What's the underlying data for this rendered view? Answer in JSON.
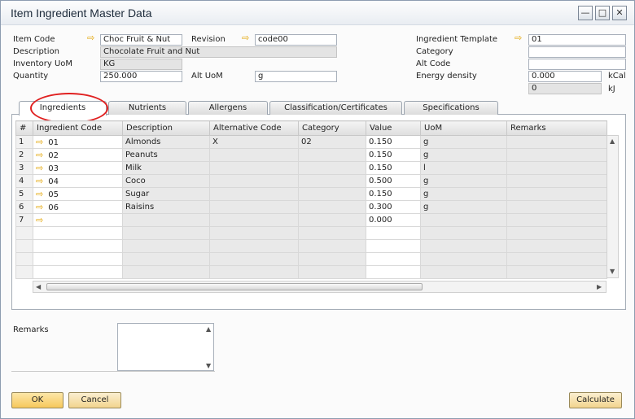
{
  "window": {
    "title": "Item Ingredient Master Data",
    "minimize": "—",
    "maximize": "□",
    "close": "✕"
  },
  "header": {
    "item_code_label": "Item Code",
    "item_code": "Choc Fruit & Nut",
    "revision_label": "Revision",
    "revision": "code00",
    "description_label": "Description",
    "description": "Chocolate Fruit and Nut",
    "inv_uom_label": "Inventory UoM",
    "inv_uom": "KG",
    "quantity_label": "Quantity",
    "quantity": "250.000",
    "alt_uom_label": "Alt UoM",
    "alt_uom": "g",
    "ingredient_template_label": "Ingredient Template",
    "ingredient_template": "01",
    "category_label": "Category",
    "category": "",
    "alt_code_label": "Alt Code",
    "alt_code": "",
    "energy_label": "Energy density",
    "energy_kcal": "0.000",
    "kcal_unit": "kCal",
    "energy_kj": "0",
    "kj_unit": "kJ"
  },
  "tabs": [
    "Ingredients",
    "Nutrients",
    "Allergens",
    "Classification/Certificates",
    "Specifications"
  ],
  "grid": {
    "columns": [
      "#",
      "Ingredient Code",
      "Description",
      "Alternative Code",
      "Category",
      "Value",
      "UoM",
      "Remarks"
    ],
    "rows": [
      {
        "n": "1",
        "code": "01",
        "desc": "Almonds",
        "alt": "X",
        "cat": "02",
        "value": "0.150",
        "uom": "g",
        "remarks": ""
      },
      {
        "n": "2",
        "code": "02",
        "desc": "Peanuts",
        "alt": "",
        "cat": "",
        "value": "0.150",
        "uom": "g",
        "remarks": ""
      },
      {
        "n": "3",
        "code": "03",
        "desc": "Milk",
        "alt": "",
        "cat": "",
        "value": "0.150",
        "uom": "l",
        "remarks": ""
      },
      {
        "n": "4",
        "code": "04",
        "desc": "Coco",
        "alt": "",
        "cat": "",
        "value": "0.500",
        "uom": "g",
        "remarks": ""
      },
      {
        "n": "5",
        "code": "05",
        "desc": "Sugar",
        "alt": "",
        "cat": "",
        "value": "0.150",
        "uom": "g",
        "remarks": ""
      },
      {
        "n": "6",
        "code": "06",
        "desc": "Raisins",
        "alt": "",
        "cat": "",
        "value": "0.300",
        "uom": "g",
        "remarks": ""
      },
      {
        "n": "7",
        "code": "",
        "desc": "",
        "alt": "",
        "cat": "",
        "value": "0.000",
        "uom": "",
        "remarks": ""
      }
    ],
    "empty_rows": 4
  },
  "remarks_label": "Remarks",
  "buttons": {
    "ok": "OK",
    "cancel": "Cancel",
    "calculate": "Calculate"
  },
  "colors": {
    "accent_arrow": "#e3a400",
    "highlight_circle": "#e02020",
    "button_gold": "#f6c85c"
  }
}
